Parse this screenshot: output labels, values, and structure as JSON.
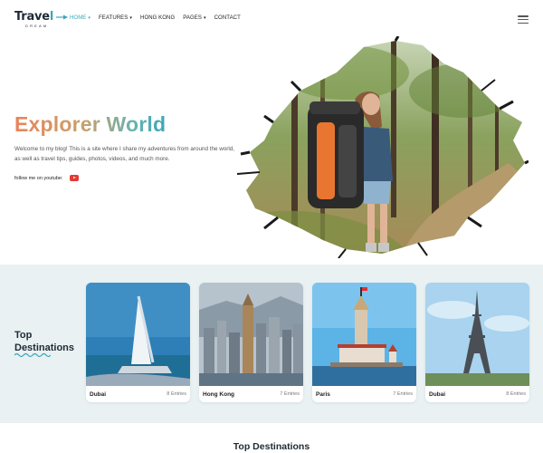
{
  "logo": {
    "word_main": "Trave",
    "word_accent": "l",
    "tagline": "DREAM"
  },
  "nav": {
    "items": [
      {
        "label": "HOME",
        "caret": "▾"
      },
      {
        "label": "FEATURES",
        "caret": "▾"
      },
      {
        "label": "HONG KONG",
        "caret": ""
      },
      {
        "label": "PAGES",
        "caret": "▾"
      },
      {
        "label": "CONTACT",
        "caret": ""
      }
    ],
    "active": "HOME",
    "menu_icon": "hamburger-icon"
  },
  "hero": {
    "title": "Explorer World",
    "description": "Welcome to my blog! This is a site where I share my adventures from around the world, as well as travel tips, guides, photos, videos, and much more.",
    "follow_label": "follow me on youtube:",
    "social_icon": "youtube-icon"
  },
  "destinations": {
    "title_line1": "Top",
    "title_line2": "Destinations",
    "cards": [
      {
        "name": "Dubai",
        "entries": "8 Entries"
      },
      {
        "name": "Hong Kong",
        "entries": "7 Entries"
      },
      {
        "name": "Paris",
        "entries": "7 Entries"
      },
      {
        "name": "Dubai",
        "entries": "8 Entries"
      }
    ]
  },
  "section2": {
    "title": "Top Destinations"
  },
  "colors": {
    "accent": "#3aa6b9",
    "brand_dark": "#1e2a36",
    "title_gradient_start": "#e8845a",
    "band_bg": "#e9f1f2",
    "youtube": "#e53935"
  }
}
